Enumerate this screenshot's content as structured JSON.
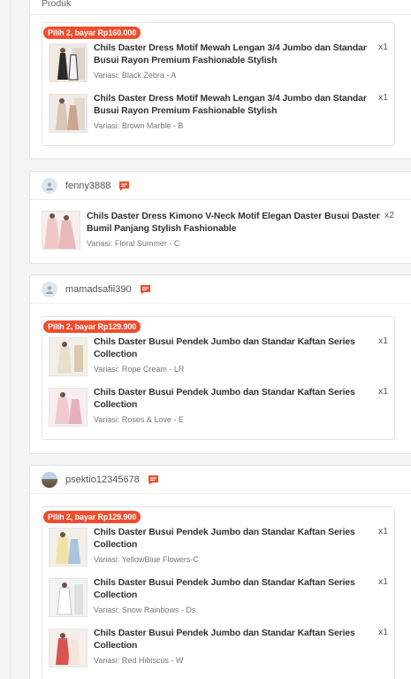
{
  "header": {
    "label": "Produk"
  },
  "orders": [
    {
      "promo": "Pilih 2, bayar Rp160.000",
      "items": [
        {
          "name": "Chils Daster Dress Motif Mewah Lengan 3/4 Jumbo dan Standar Busui Rayon Premium Fashionable Stylish",
          "variant": "Variasi: Black Zebra - A",
          "qty": "x1"
        },
        {
          "name": "Chils Daster Dress Motif Mewah Lengan 3/4 Jumbo dan Standar Busui Rayon Premium Fashionable Stylish",
          "variant": "Variasi: Brown Marble - B",
          "qty": "x1"
        }
      ]
    },
    {
      "buyer": "fenny3888",
      "items": [
        {
          "name": "Chils Daster Dress Kimono V-Neck Motif Elegan Daster Busui Daster Bumil Panjang Stylish Fashionable",
          "variant": "Variasi: Floral Summer - C",
          "qty": "x2"
        }
      ]
    },
    {
      "buyer": "mamadsafii390",
      "promo": "Pilih 2, bayar Rp129.900",
      "items": [
        {
          "name": "Chils Daster Busui Pendek Jumbo dan Standar Kaftan Series Collection",
          "variant": "Variasi: Rope Cream - LR",
          "qty": "x1"
        },
        {
          "name": "Chils Daster Busui Pendek Jumbo dan Standar Kaftan Series Collection",
          "variant": "Variasi: Roses & Love - E",
          "qty": "x1"
        }
      ]
    },
    {
      "buyer": "psektio12345678",
      "promo": "Pilih 2, bayar Rp129.900",
      "items": [
        {
          "name": "Chils Daster Busui Pendek Jumbo dan Standar Kaftan Series Collection",
          "variant": "Variasi: YellowBlue Flowers-C",
          "qty": "x1"
        },
        {
          "name": "Chils Daster Busui Pendek Jumbo dan Standar Kaftan Series Collection",
          "variant": "Variasi: Snow Rainbows - Ds",
          "qty": "x1"
        },
        {
          "name": "Chils Daster Busui Pendek Jumbo dan Standar Kaftan Series Collection",
          "variant": "Variasi: Red Hibiscus - W",
          "qty": "x1"
        }
      ]
    }
  ],
  "icons": {
    "avatar": "user-avatar-icon",
    "chat": "chat-icon"
  },
  "colors": {
    "accent": "#ee4d2d",
    "border": "#e3e3e3",
    "background": "#f5f5f5"
  }
}
